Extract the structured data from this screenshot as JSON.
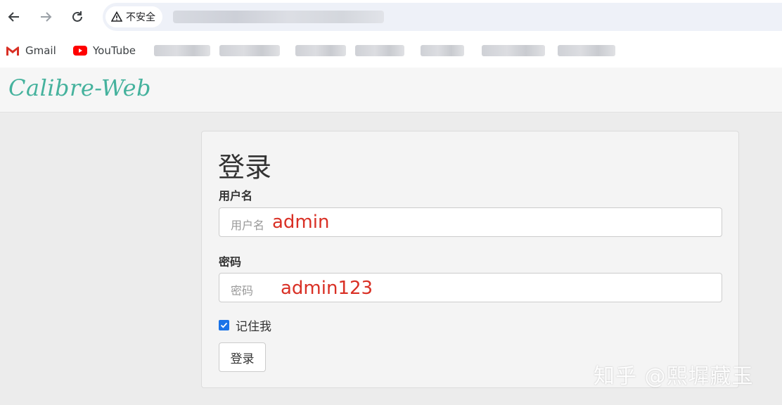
{
  "browser": {
    "security_label": "不安全",
    "bookmarks": [
      {
        "label": "Gmail",
        "icon": "gmail-icon"
      },
      {
        "label": "YouTube",
        "icon": "youtube-icon"
      }
    ]
  },
  "app": {
    "brand": "Calibre-Web"
  },
  "login": {
    "title": "登录",
    "username_label": "用户名",
    "username_placeholder": "用户名",
    "username_value": "admin",
    "password_label": "密码",
    "password_placeholder": "密码",
    "password_value": "admin123",
    "remember_label": "记住我",
    "remember_checked": true,
    "submit_label": "登录"
  },
  "watermark": "知乎 @熙墀藏玉",
  "colors": {
    "brand": "#45b29d",
    "annotation": "#d93025",
    "checkbox": "#1a73e8"
  }
}
